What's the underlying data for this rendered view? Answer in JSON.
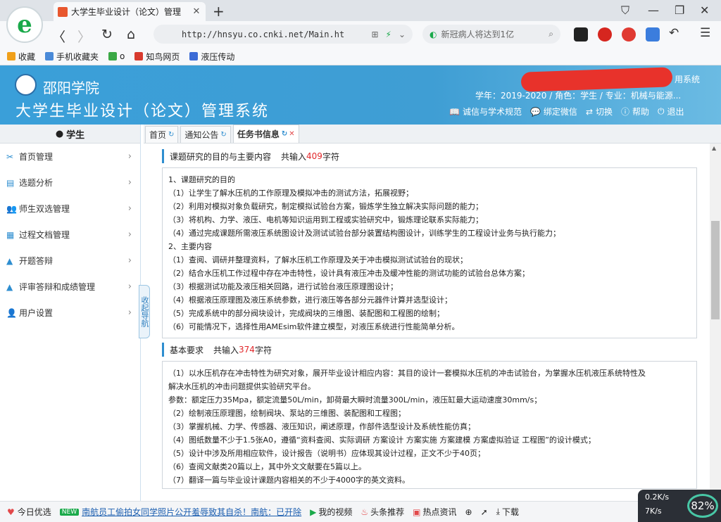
{
  "browser": {
    "tab_title": "大学生毕业设计（论文）管理",
    "url": "http://hnsyu.co.cnki.net/Main.ht",
    "search_placeholder": "新冠病人将达到1亿"
  },
  "bookmarks": [
    {
      "label": "收藏",
      "color": "#f0a01a"
    },
    {
      "label": "手机收藏夹",
      "color": "#4a8ad8"
    },
    {
      "label": "o",
      "color": "#3aa845"
    },
    {
      "label": "知鸟网页",
      "color": "#d83a2e"
    },
    {
      "label": "液压传动",
      "color": "#3b6bd6"
    }
  ],
  "header": {
    "school": "邵阳学院",
    "system": "大学生毕业设计（论文）管理系统",
    "system_right": "用系统",
    "user_info": "学年：2019-2020 / 角色：学生 / 专业：机械与能源...",
    "links": [
      {
        "icon": "📖",
        "label": "诚信与学术规范"
      },
      {
        "icon": "💬",
        "label": "绑定微信"
      },
      {
        "icon": "⇄",
        "label": "切换"
      },
      {
        "icon": "ⓘ",
        "label": "帮助"
      },
      {
        "icon": "⏻",
        "label": "退出"
      }
    ]
  },
  "sidebar": {
    "role": "学生",
    "items": [
      {
        "label": "首页管理",
        "icon": "✂"
      },
      {
        "label": "选题分析",
        "icon": "▤"
      },
      {
        "label": "师生双选管理",
        "icon": "👥"
      },
      {
        "label": "过程文档管理",
        "icon": "▦"
      },
      {
        "label": "开题答辩",
        "icon": "▲"
      },
      {
        "label": "评审答辩和成绩管理",
        "icon": "▲"
      },
      {
        "label": "用户设置",
        "icon": "👤"
      }
    ],
    "collapse": "收起导航"
  },
  "tabs": [
    {
      "label": "首页"
    },
    {
      "label": "通知公告"
    },
    {
      "label": "任务书信息"
    }
  ],
  "content": {
    "section1": {
      "title": "课题研究的目的与主要内容",
      "count_prefix": "共输入",
      "count": "409",
      "count_suffix": "字符",
      "lines": [
        "1、课题研究的目的",
        "（1）让学生了解水压机的工作原理及模拟冲击的测试方法，拓展视野；",
        "（2）利用对模拟对象负载研究，制定模拟试验台方案，锻炼学生独立解决实际问题的能力；",
        "（3）将机构、力学、液压、电机等知识运用到工程或实验研究中，锻炼理论联系实际能力；",
        "（4）通过完成课题所需液压系统图设计及测试试验台部分装置结构图设计，训练学生的工程设计业务与执行能力；",
        "2、主要内容",
        "（1）查阅、调研并整理资料，了解水压机工作原理及关于冲击模拟测试试验台的现状；",
        "（2）结合水压机工作过程中存在冲击特性，设计具有液压冲击及缓冲性能的测试功能的试验台总体方案；",
        "（3）根据测试功能及液压相关回路，进行试验台液压原理图设计；",
        "（4）根据液压原理图及液压系统参数，进行液压等各部分元器件计算并选型设计；",
        "（5）完成系统中的部分阀块设计，完成阀块的三维图、装配图和工程图的绘制；",
        "（6）可能情况下，选择性用AMEsim软件建立模型，对液压系统进行性能简单分析。"
      ]
    },
    "section2": {
      "title": "基本要求",
      "count_prefix": "共输入",
      "count": "374",
      "count_suffix": "字符",
      "lines": [
        "（1）以水压机存在冲击特性为研究对象，展开毕业设计相应内容：其目的设计一套模拟水压机的冲击试验台，为掌握水压机液压系统特性及",
        "解决水压机的冲击问题提供实验研究平台。",
        "参数：额定压力35Mpa，额定流量50L/min，卸荷最大瞬时流量300L/min，液压缸最大运动速度30mm/s；",
        "（2）绘制液压原理图，绘制阀块、泵站的三维图、装配图和工程图；",
        "（3）掌握机械、力学、传感器、液压知识，阐述原理，作部件选型设计及系统性能仿真；",
        "（4）图纸数量不少于1.5张A0，遵循“资料查阅、实际调研  方案设计  方案实施  方案建模  方案虚拟验证  工程图”的设计模式；",
        "（5）设计中涉及所用相应软件，设计报告（说明书）应体现其设计过程，正文不少于40页；",
        "（6）查阅文献类20篇以上，其中外文文献要在5篇以上。",
        "（7）翻译一篇与毕业设计课题内容相关的不少于4000字的英文资料。"
      ]
    }
  },
  "statusbar": {
    "items": [
      {
        "label": "今日优选"
      },
      {
        "label": "南航员工偷拍女同学照片公开羞辱致其自杀！南航：已开除"
      },
      {
        "label": "我的视频"
      },
      {
        "label": "头条推荐"
      },
      {
        "label": "热点资讯"
      },
      {
        "label": "下载"
      }
    ],
    "new_badge": "NEW",
    "up_speed": "0.2K/s",
    "down_speed": "7K/s",
    "cpu": "82%"
  }
}
